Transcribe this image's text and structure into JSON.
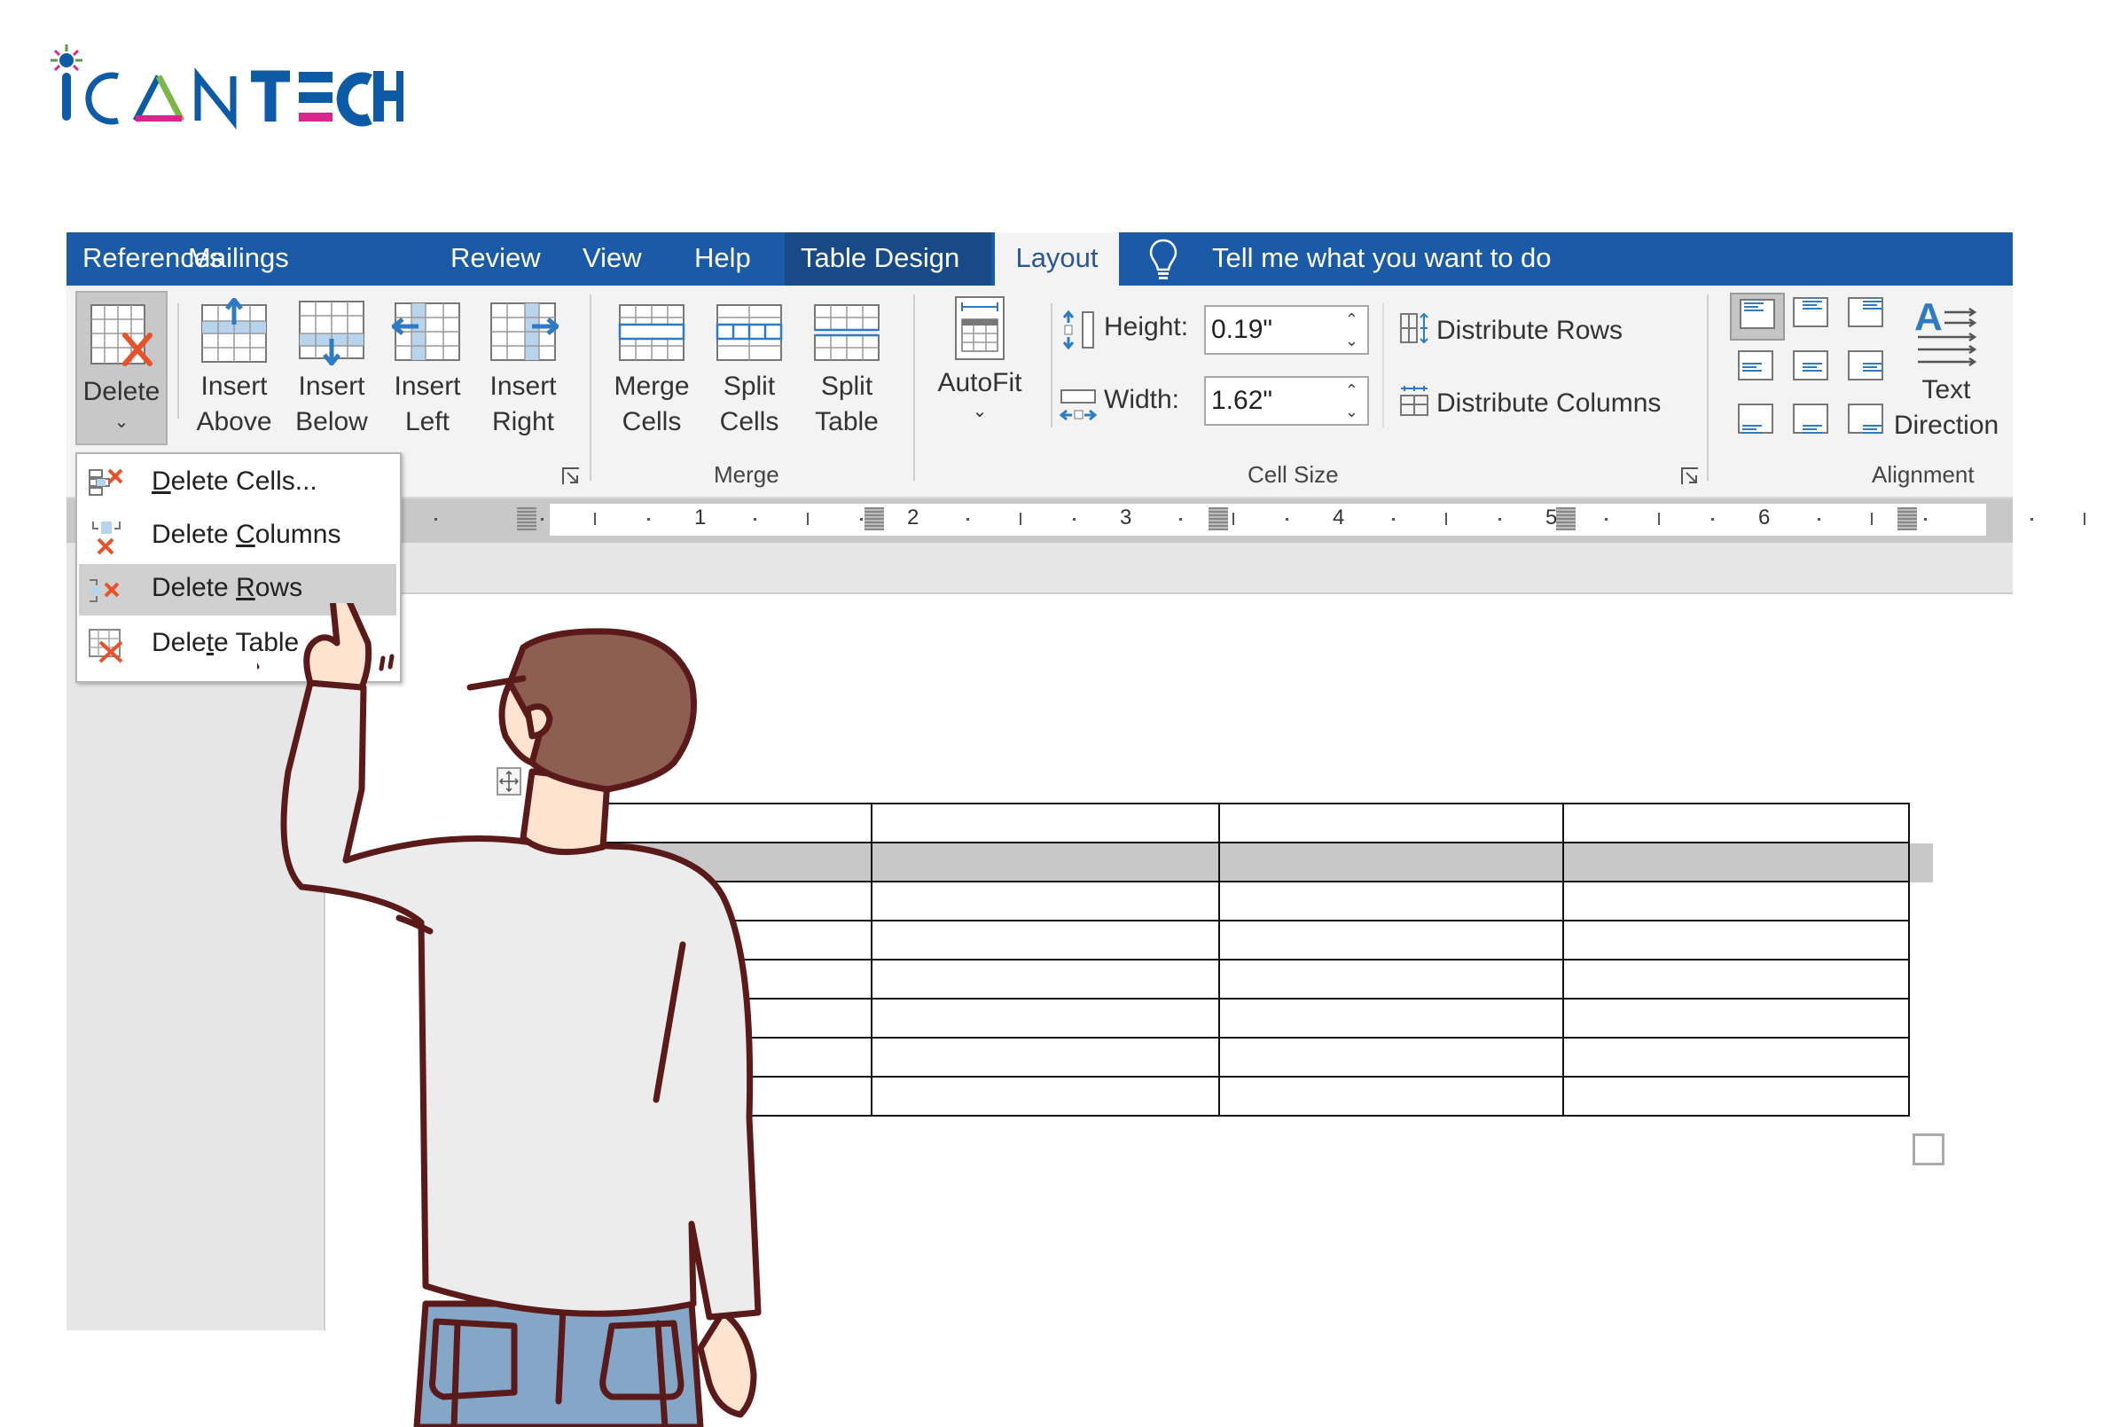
{
  "brand": {
    "logo_thin": "iCΛN",
    "logo_bold": "TECH",
    "colors": {
      "primary": "#0d5aa7",
      "accent_pink": "#d9268f",
      "accent_green": "#7ab648"
    }
  },
  "ribbon_tabs": {
    "items": [
      {
        "label": "References"
      },
      {
        "label": "Mailings"
      },
      {
        "label": "Review"
      },
      {
        "label": "View"
      },
      {
        "label": "Help"
      },
      {
        "label": "Table Design"
      },
      {
        "label": "Layout",
        "active": true
      }
    ],
    "tell_me": "Tell me what you want to do",
    "colors": {
      "bar": "#1a5aa6",
      "contextual": "#174a86",
      "ribbon_bg": "#f3f3f3"
    }
  },
  "ribbon": {
    "rows_columns": {
      "delete": {
        "label": "Delete",
        "icon": "delete-table-icon"
      },
      "insert_above": {
        "line1": "Insert",
        "line2": "Above"
      },
      "insert_below": {
        "line1": "Insert",
        "line2": "Below"
      },
      "insert_left": {
        "line1": "Insert",
        "line2": "Left"
      },
      "insert_right": {
        "line1": "Insert",
        "line2": "Right"
      }
    },
    "merge": {
      "group_label": "Merge",
      "merge_cells": {
        "line1": "Merge",
        "line2": "Cells"
      },
      "split_cells": {
        "line1": "Split",
        "line2": "Cells"
      },
      "split_table": {
        "line1": "Split",
        "line2": "Table"
      }
    },
    "cell_size": {
      "group_label": "Cell Size",
      "autofit": "AutoFit",
      "height_label": "Height:",
      "height_value": "0.19\"",
      "width_label": "Width:",
      "width_value": "1.62\"",
      "distribute_rows": "Distribute Rows",
      "distribute_columns": "Distribute Columns"
    },
    "alignment": {
      "group_label": "Alignment",
      "text_direction_line1": "Text",
      "text_direction_line2": "Direction",
      "selected_cell": "top-left"
    }
  },
  "delete_menu": {
    "items": [
      {
        "pre": "",
        "ul": "D",
        "post": "elete Cells...",
        "icon": "delete-cells-icon"
      },
      {
        "pre": "Delete ",
        "ul": "C",
        "post": "olumns",
        "icon": "delete-columns-icon"
      },
      {
        "pre": "Delete ",
        "ul": "R",
        "post": "ows",
        "icon": "delete-rows-icon",
        "highlighted": true
      },
      {
        "pre": "Dele",
        "ul": "t",
        "post": "e Table",
        "icon": "delete-table-icon"
      }
    ]
  },
  "ruler": {
    "numbers": [
      "1",
      "2",
      "3",
      "4",
      "5",
      "6"
    ]
  },
  "document_table": {
    "rows": 8,
    "columns": 4,
    "selected_row": 2
  }
}
